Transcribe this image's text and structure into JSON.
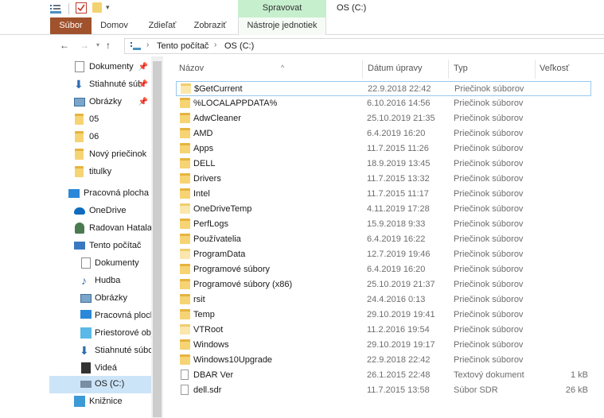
{
  "window": {
    "title": "OS (C:)",
    "context_header": "Spravovat"
  },
  "ribbon": {
    "tabs": [
      "Súbor",
      "Domov",
      "Zdieľať",
      "Zobraziť",
      "Nástroje jednotiek"
    ]
  },
  "address": {
    "parts": [
      "Tento počítač",
      "OS (C:)"
    ]
  },
  "sidebar": {
    "quick_access": [
      {
        "label": "Dokumenty",
        "icon": "document-icon",
        "pinned": true
      },
      {
        "label": "Stiahnuté súb",
        "icon": "download-arrow-icon",
        "pinned": true
      },
      {
        "label": "Obrázky",
        "icon": "pictures-icon",
        "pinned": true
      },
      {
        "label": "05",
        "icon": "folder-icon",
        "pinned": false
      },
      {
        "label": "06",
        "icon": "folder-icon",
        "pinned": false
      },
      {
        "label": "Nový priečinok",
        "icon": "folder-icon",
        "pinned": false
      },
      {
        "label": "titulky",
        "icon": "folder-icon",
        "pinned": false
      }
    ],
    "desktop": "Pracovná plocha",
    "onedrive": "OneDrive",
    "user": "Radovan Hatala",
    "this_pc": "Tento počítač",
    "pc_items": [
      "Dokumenty",
      "Hudba",
      "Obrázky",
      "Pracovná ploch",
      "Priestorové obj",
      "Stiahnuté súbo",
      "Videá",
      "OS (C:)"
    ],
    "libraries": "Knižnice"
  },
  "columns": {
    "name": "Názov",
    "date": "Dátum úpravy",
    "type": "Typ",
    "size": "Veľkosť"
  },
  "files": [
    {
      "name": "$GetCurrent",
      "date": "22.9.2018 22:42",
      "type": "Priečinok súborov",
      "size": "",
      "kind": "folder-light"
    },
    {
      "name": "%LOCALAPPDATA%",
      "date": "6.10.2016 14:56",
      "type": "Priečinok súborov",
      "size": "",
      "kind": "folder"
    },
    {
      "name": "AdwCleaner",
      "date": "25.10.2019 21:35",
      "type": "Priečinok súborov",
      "size": "",
      "kind": "folder"
    },
    {
      "name": "AMD",
      "date": "6.4.2019 16:20",
      "type": "Priečinok súborov",
      "size": "",
      "kind": "folder"
    },
    {
      "name": "Apps",
      "date": "11.7.2015 11:26",
      "type": "Priečinok súborov",
      "size": "",
      "kind": "folder"
    },
    {
      "name": "DELL",
      "date": "18.9.2019 13:45",
      "type": "Priečinok súborov",
      "size": "",
      "kind": "folder"
    },
    {
      "name": "Drivers",
      "date": "11.7.2015 13:32",
      "type": "Priečinok súborov",
      "size": "",
      "kind": "folder"
    },
    {
      "name": "Intel",
      "date": "11.7.2015 11:17",
      "type": "Priečinok súborov",
      "size": "",
      "kind": "folder"
    },
    {
      "name": "OneDriveTemp",
      "date": "4.11.2019 17:28",
      "type": "Priečinok súborov",
      "size": "",
      "kind": "folder-light"
    },
    {
      "name": "PerfLogs",
      "date": "15.9.2018 9:33",
      "type": "Priečinok súborov",
      "size": "",
      "kind": "folder"
    },
    {
      "name": "Používatelia",
      "date": "6.4.2019 16:22",
      "type": "Priečinok súborov",
      "size": "",
      "kind": "folder"
    },
    {
      "name": "ProgramData",
      "date": "12.7.2019 19:46",
      "type": "Priečinok súborov",
      "size": "",
      "kind": "folder-light"
    },
    {
      "name": "Programové súbory",
      "date": "6.4.2019 16:20",
      "type": "Priečinok súborov",
      "size": "",
      "kind": "folder"
    },
    {
      "name": "Programové súbory (x86)",
      "date": "25.10.2019 21:37",
      "type": "Priečinok súborov",
      "size": "",
      "kind": "folder"
    },
    {
      "name": "rsit",
      "date": "24.4.2016 0:13",
      "type": "Priečinok súborov",
      "size": "",
      "kind": "folder"
    },
    {
      "name": "Temp",
      "date": "29.10.2019 19:41",
      "type": "Priečinok súborov",
      "size": "",
      "kind": "folder"
    },
    {
      "name": "VTRoot",
      "date": "11.2.2016 19:54",
      "type": "Priečinok súborov",
      "size": "",
      "kind": "folder-light"
    },
    {
      "name": "Windows",
      "date": "29.10.2019 19:17",
      "type": "Priečinok súborov",
      "size": "",
      "kind": "folder"
    },
    {
      "name": "Windows10Upgrade",
      "date": "22.9.2018 22:42",
      "type": "Priečinok súborov",
      "size": "",
      "kind": "folder"
    },
    {
      "name": "DBAR Ver",
      "date": "26.1.2015 22:48",
      "type": "Textový dokument",
      "size": "1 kB",
      "kind": "file"
    },
    {
      "name": "dell.sdr",
      "date": "11.7.2015 13:58",
      "type": "Súbor SDR",
      "size": "26 kB",
      "kind": "file"
    }
  ],
  "colors": {
    "file_tab": "#a0522d",
    "context_tab": "#c6efce",
    "selection": "#cce4f7",
    "folder": "#f6d474"
  }
}
